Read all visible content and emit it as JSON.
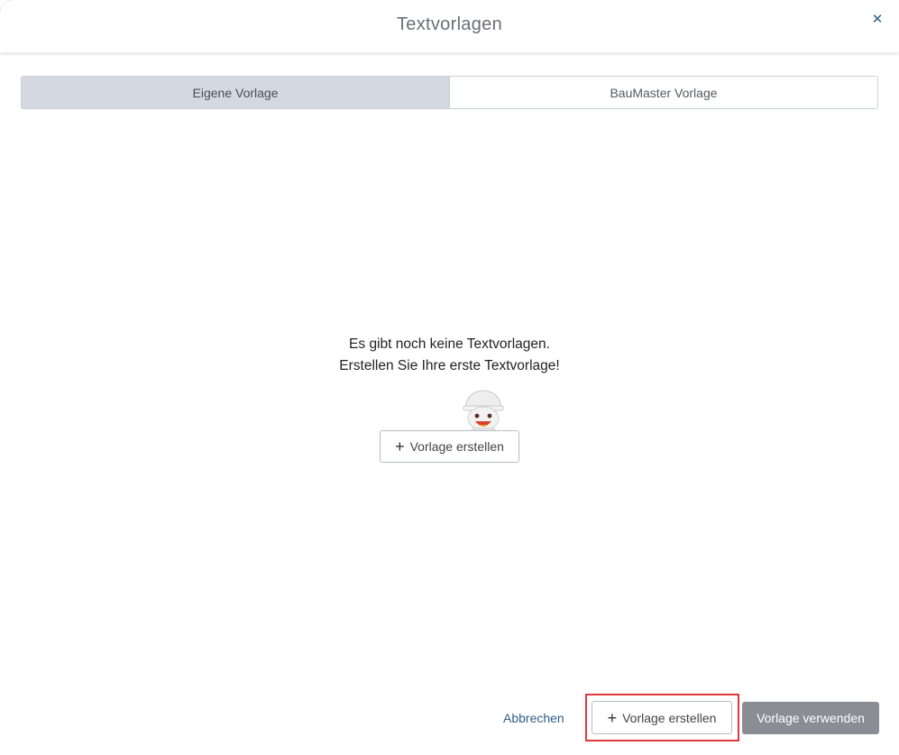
{
  "header": {
    "title": "Textvorlagen",
    "close_icon": "close-icon"
  },
  "tabs": [
    {
      "label": "Eigene Vorlage",
      "active": true
    },
    {
      "label": "BauMaster Vorlage",
      "active": false
    }
  ],
  "empty_state": {
    "line1": "Es gibt noch keine Textvorlagen.",
    "line2": "Erstellen Sie Ihre erste Textvorlage!",
    "mascot_icon": "construction-worker-mascot",
    "create_label": "Vorlage erstellen"
  },
  "footer": {
    "cancel_label": "Abbrechen",
    "create_label": "Vorlage erstellen",
    "use_label": "Vorlage verwenden"
  },
  "colors": {
    "accent_link": "#2f5d87",
    "tab_active_bg": "#d4d9e1",
    "primary_disabled_bg": "#8a8d93",
    "highlight": "#e0383e"
  }
}
